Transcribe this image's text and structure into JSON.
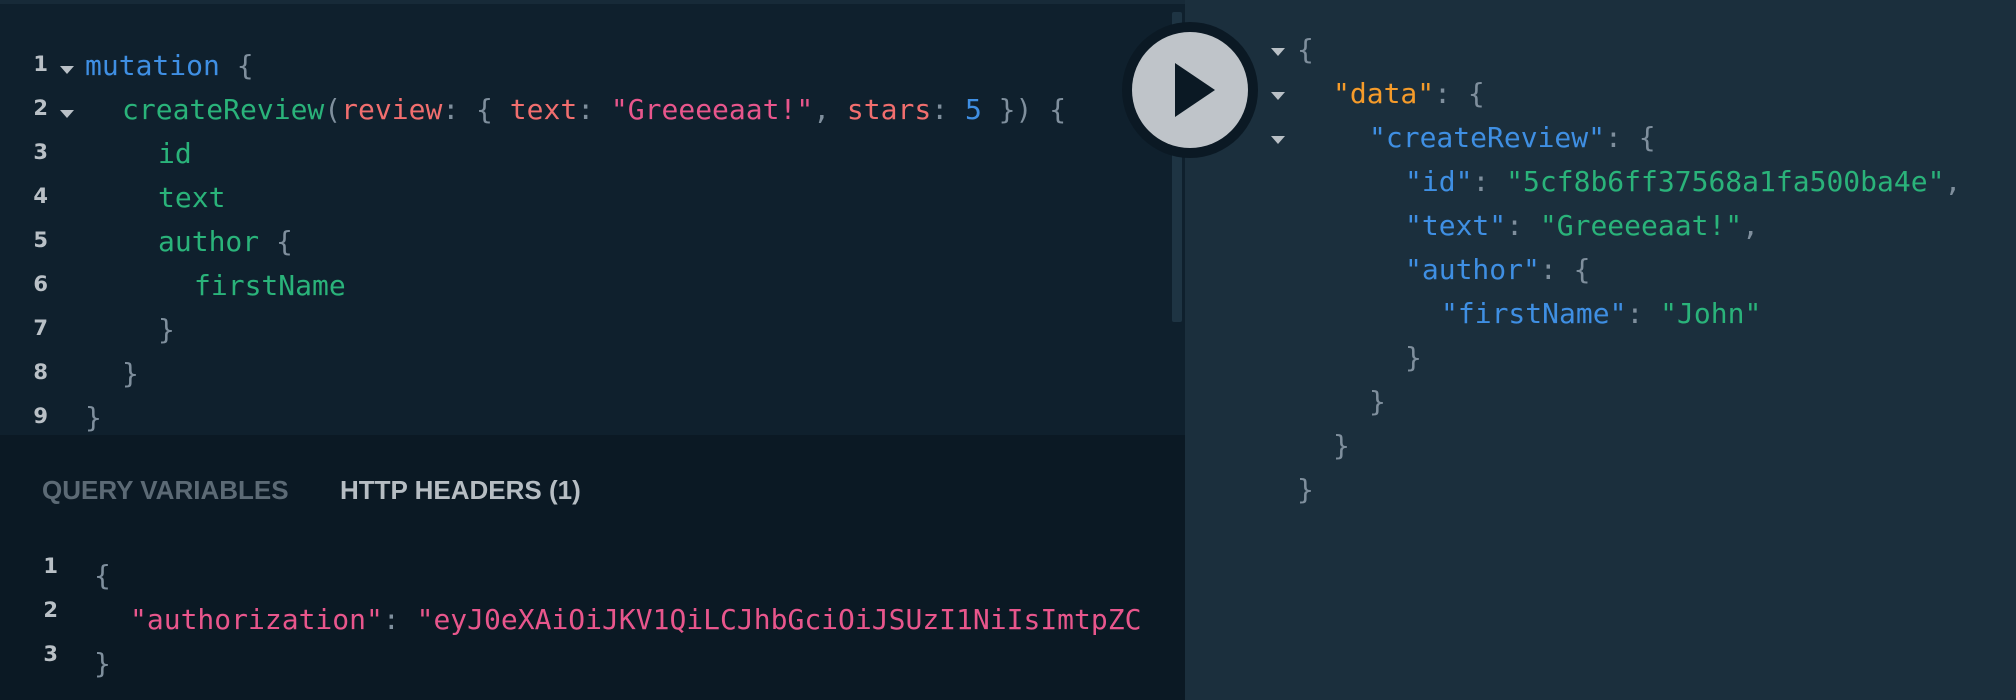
{
  "query_editor": {
    "line_numbers": [
      "1",
      "2",
      "3",
      "4",
      "5",
      "6",
      "7",
      "8",
      "9"
    ],
    "line1": {
      "keyword": "mutation",
      "brace": "{"
    },
    "line2": {
      "field": "createReview",
      "open_paren": "(",
      "arg_name": "review",
      "colon": ":",
      "open_obj": "{",
      "key_text": "text",
      "colon2": ":",
      "text_value": "\"Greeeeaat!\"",
      "comma": ",",
      "key_stars": "stars",
      "colon3": ":",
      "stars_value": "5",
      "close_obj_paren": "})",
      "brace": "{"
    },
    "line3": "id",
    "line4": "text",
    "line5": {
      "field": "author",
      "brace": "{"
    },
    "line6": "firstName",
    "line7": "}",
    "line8": "}",
    "line9": "}"
  },
  "variables_panel": {
    "tabs": [
      {
        "label": "QUERY VARIABLES",
        "active": false
      },
      {
        "label": "HTTP HEADERS (1)",
        "active": true
      }
    ],
    "line_numbers": [
      "1",
      "2",
      "3"
    ],
    "line1": "{",
    "line2": {
      "key": "\"authorization\"",
      "colon": ":",
      "value": "\"eyJ0eXAiOiJKV1QiLCJhbGciOiJSUzI1NiIsImtpZC"
    },
    "line3": "}"
  },
  "run_button": {
    "icon": "play-icon"
  },
  "result_viewer": {
    "line1": "{",
    "line2": {
      "key": "\"data\"",
      "colon": ":",
      "brace": "{"
    },
    "line3": {
      "key": "\"createReview\"",
      "colon": ":",
      "brace": "{"
    },
    "line4": {
      "key": "\"id\"",
      "colon": ":",
      "value": "\"5cf8b6ff37568a1fa500ba4e\"",
      "comma": ","
    },
    "line5": {
      "key": "\"text\"",
      "colon": ":",
      "value": "\"Greeeeaat!\"",
      "comma": ","
    },
    "line6": {
      "key": "\"author\"",
      "colon": ":",
      "brace": "{"
    },
    "line7": {
      "key": "\"firstName\"",
      "colon": ":",
      "value": "\"John\""
    },
    "line8": "}",
    "line9": "}",
    "line10": "}",
    "line11": "}"
  },
  "colors": {
    "editor_bg": "#0f202d",
    "result_bg": "#1b2f3d",
    "variables_bg": "#0b1924",
    "keyword": "#3f8fe3",
    "field": "#2ab37a",
    "argument": "#f16e6e",
    "string": "#e8568c",
    "json_top_key": "#f59b2a",
    "json_key": "#3f8fe3",
    "json_string": "#2ab37a"
  }
}
